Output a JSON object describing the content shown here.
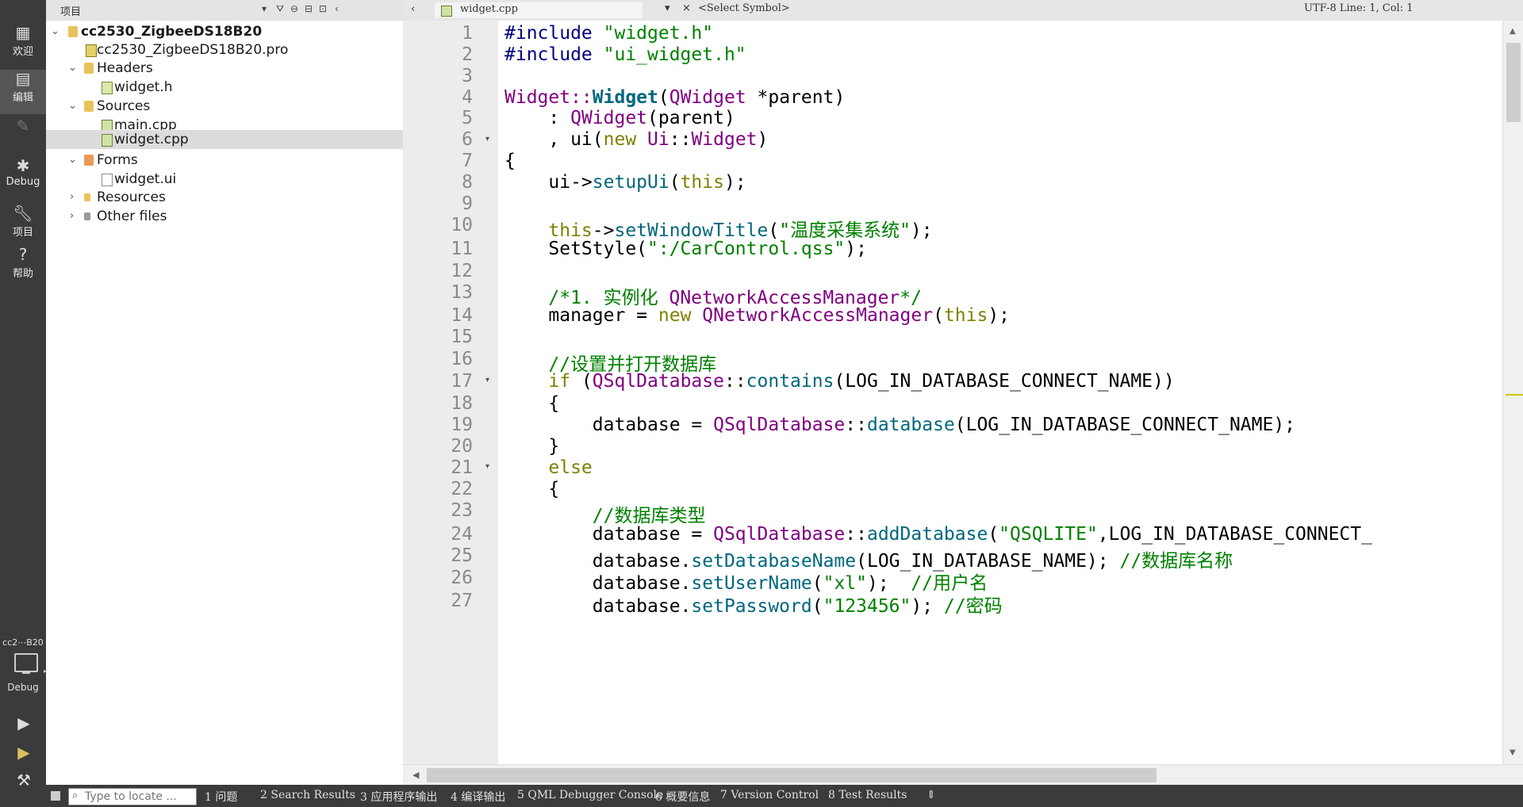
{
  "modes": {
    "welcome": "欢迎",
    "edit": "编辑",
    "debug": "Debug",
    "project": "项目",
    "help": "帮助"
  },
  "kit": {
    "name": "cc2⋯B20",
    "config": "Debug"
  },
  "sidebar": {
    "title": "项目",
    "tree": [
      {
        "label": "cc2530_ZigbeeDS18B20"
      },
      {
        "label": "cc2530_ZigbeeDS18B20.pro"
      },
      {
        "label": "Headers"
      },
      {
        "label": "widget.h"
      },
      {
        "label": "Sources"
      },
      {
        "label": "main.cpp"
      },
      {
        "label": "widget.cpp"
      },
      {
        "label": "Forms"
      },
      {
        "label": "widget.ui"
      },
      {
        "label": "Resources"
      },
      {
        "label": "Other files"
      }
    ]
  },
  "editor": {
    "file_tab": "widget.cpp",
    "symbol": "<Select Symbol>",
    "status": "UTF-8 Line: 1, Col: 1",
    "line_numbers": [
      "1",
      "2",
      "3",
      "4",
      "5",
      "6",
      "7",
      "8",
      "9",
      "10",
      "11",
      "12",
      "13",
      "14",
      "15",
      "16",
      "17",
      "18",
      "19",
      "20",
      "21",
      "22",
      "23",
      "24",
      "25",
      "26",
      "27"
    ],
    "code": {
      "l1_a": "#include ",
      "l1_b": "\"widget.h\"",
      "l2_a": "#include ",
      "l2_b": "\"ui_widget.h\"",
      "l4_a": "Widget::",
      "l4_b": "Widget",
      "l4_c": "(",
      "l4_d": "QWidget",
      "l4_e": " *parent)",
      "l5_a": "    : ",
      "l5_b": "QWidget",
      "l5_c": "(parent)",
      "l6_a": "    , ui(",
      "l6_b": "new",
      "l6_c": " ",
      "l6_d": "Ui",
      "l6_e": "::",
      "l6_f": "Widget",
      "l6_g": ")",
      "l7": "{",
      "l8_a": "    ui->",
      "l8_b": "setupUi",
      "l8_c": "(",
      "l8_d": "this",
      "l8_e": ");",
      "l10_a": "    ",
      "l10_b": "this",
      "l10_c": "->",
      "l10_d": "setWindowTitle",
      "l10_e": "(",
      "l10_f": "\"温度采集系统\"",
      "l10_g": ");",
      "l11_a": "    SetStyle(",
      "l11_b": "\":/CarControl.qss\"",
      "l11_c": ");",
      "l13_a": "    /*1. 实例化 ",
      "l13_b": "QNetworkAccessManager",
      "l13_c": "*/",
      "l14_a": "    manager = ",
      "l14_b": "new",
      "l14_c": " ",
      "l14_d": "QNetworkAccessManager",
      "l14_e": "(",
      "l14_f": "this",
      "l14_g": ");",
      "l16": "    //设置并打开数据库",
      "l17_a": "    ",
      "l17_b": "if",
      "l17_c": " (",
      "l17_d": "QSqlDatabase",
      "l17_e": "::",
      "l17_f": "contains",
      "l17_g": "(LOG_IN_DATABASE_CONNECT_NAME))",
      "l18": "    {",
      "l19_a": "        database = ",
      "l19_b": "QSqlDatabase",
      "l19_c": "::",
      "l19_d": "database",
      "l19_e": "(LOG_IN_DATABASE_CONNECT_NAME);",
      "l20": "    }",
      "l21": "    else",
      "l22": "    {",
      "l23": "        //数据库类型",
      "l24_a": "        database = ",
      "l24_b": "QSqlDatabase",
      "l24_c": "::",
      "l24_d": "addDatabase",
      "l24_e": "(",
      "l24_f": "\"QSQLITE\"",
      "l24_g": ",LOG_IN_DATABASE_CONNECT_",
      "l25_a": "        database.",
      "l25_b": "setDatabaseName",
      "l25_c": "(LOG_IN_DATABASE_NAME); ",
      "l25_d": "//数据库名称",
      "l26_a": "        database.",
      "l26_b": "setUserName",
      "l26_c": "(",
      "l26_d": "\"xl\"",
      "l26_e": ");  ",
      "l26_f": "//用户名",
      "l27_a": "        database.",
      "l27_b": "setPassword",
      "l27_c": "(",
      "l27_d": "\"123456\"",
      "l27_e": "); ",
      "l27_f": "//密码"
    }
  },
  "output_bar": {
    "locator_placeholder": "Type to locate ...",
    "tabs": [
      "1 问题",
      "2 Search Results",
      "3 应用程序输出",
      "4 编译输出",
      "5 QML Debugger Console",
      "6 概要信息",
      "7 Version Control",
      "8 Test Results"
    ]
  },
  "colors": {
    "keyword": "#808000",
    "preprocessor": "#000080",
    "string": "#008000",
    "class": "#800080",
    "function": "#00677c",
    "comment": "#008000",
    "modebar": "#3b3b3b"
  }
}
